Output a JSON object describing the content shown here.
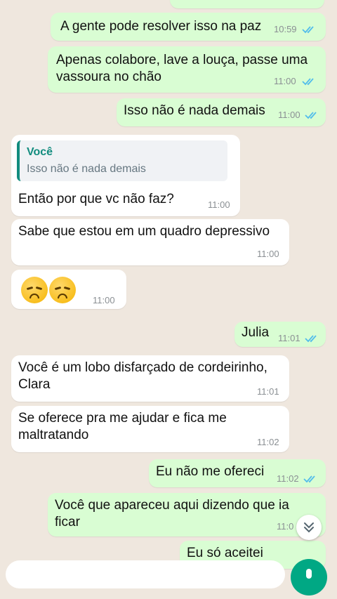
{
  "messages": [
    {
      "dir": "out",
      "text": [
        "A gente pode resolver isso na paz"
      ],
      "time": "10:59",
      "read": true
    },
    {
      "dir": "out",
      "text": [
        "Apenas colabore, lave a louça, passe uma",
        "vassoura no chão"
      ],
      "time": "11:00",
      "read": true
    },
    {
      "dir": "out",
      "text": [
        "Isso não é nada demais"
      ],
      "time": "11:00",
      "read": true
    },
    {
      "dir": "in",
      "reply": {
        "name": "Você",
        "text": "Isso não é nada demais"
      },
      "text": [
        "Então por que vc não faz?"
      ],
      "time": "11:00"
    },
    {
      "dir": "in",
      "text": [
        "Sabe que estou em um quadro depressivo"
      ],
      "time": "11:00"
    },
    {
      "dir": "in",
      "emoji": [
        "disappointed-face",
        "disappointed-face"
      ],
      "time": "11:00"
    },
    {
      "dir": "out",
      "text": [
        "Julia"
      ],
      "time": "11:01",
      "read": true
    },
    {
      "dir": "in",
      "text": [
        "Você é um lobo disfarçado de cordeirinho,",
        "Clara"
      ],
      "time": "11:01"
    },
    {
      "dir": "in",
      "text": [
        "Se oferece pra me ajudar e fica me",
        "maltratando"
      ],
      "time": "11:02"
    },
    {
      "dir": "out",
      "text": [
        "Eu não me ofereci"
      ],
      "time": "11:02",
      "read": true
    },
    {
      "dir": "out",
      "text": [
        "Você que apareceu aqui dizendo que ia",
        "ficar"
      ],
      "time": "11:0"
    },
    {
      "dir": "out",
      "text": [
        "Eu só aceitei"
      ]
    }
  ],
  "colors": {
    "outgoing": "#d9fdd3",
    "incoming": "#ffffff",
    "read_ticks": "#53bdeb",
    "accent": "#00a884"
  },
  "icons": {
    "scroll_down": "double-chevron-down-icon",
    "mic": "mic-icon",
    "read": "double-check-icon"
  }
}
